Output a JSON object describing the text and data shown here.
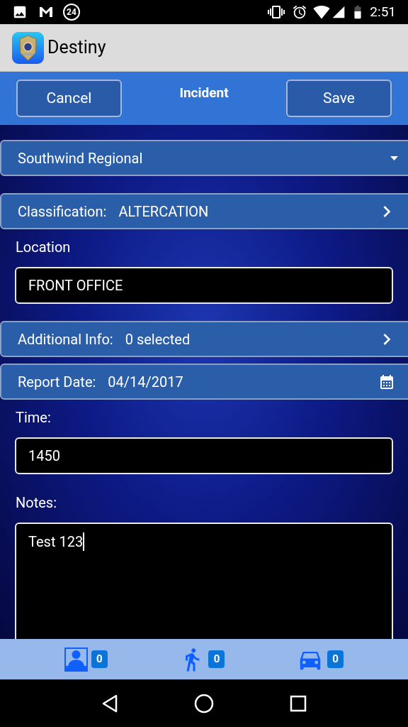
{
  "status_bar": {
    "notification_count": "24",
    "time": "2:51"
  },
  "app_bar": {
    "title": "Destiny"
  },
  "toolbar": {
    "title": "Incident",
    "buttons": [
      "Cancel",
      "Save"
    ]
  },
  "form": [
    {
      "kind": "dropdown",
      "value": "Southwind Regional"
    },
    {
      "kind": "link",
      "label": "Classification:",
      "value": "ALTERCATION"
    },
    {
      "kind": "field",
      "label": "Location",
      "value": "FRONT OFFICE"
    },
    {
      "kind": "link",
      "label": "Additional Info:",
      "value": "0 selected"
    },
    {
      "kind": "date",
      "label": "Report Date:",
      "value": "04/14/2017"
    },
    {
      "kind": "field",
      "label": "Time:",
      "value": "1450"
    },
    {
      "kind": "notes",
      "label": "Notes:",
      "value": "Test 123",
      "focused": true
    }
  ],
  "bottom_tabs": [
    {
      "kind": "people",
      "count": "0"
    },
    {
      "kind": "pedestrian",
      "count": "0"
    },
    {
      "kind": "vehicle",
      "count": "0"
    }
  ]
}
